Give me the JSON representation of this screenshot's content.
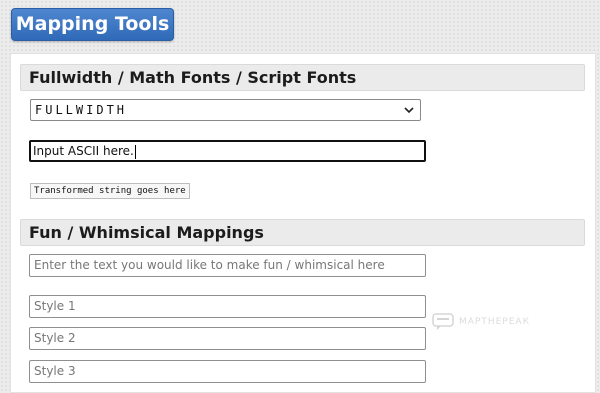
{
  "header": {
    "title": "Mapping Tools"
  },
  "fullwidth_section": {
    "title": "Fullwidth / Math Fonts / Script Fonts",
    "selected_style": "FULLWIDTH",
    "input_value": "Input ASCII here.",
    "output_text": "Transformed string goes here"
  },
  "fun_section": {
    "title": "Fun / Whimsical Mappings",
    "input_placeholder": "Enter the text you would like to make fun / whimsical here",
    "styles": [
      "Style 1",
      "Style 2",
      "Style 3"
    ]
  },
  "watermark": {
    "text": "МАРТНЕРЕАК"
  }
}
